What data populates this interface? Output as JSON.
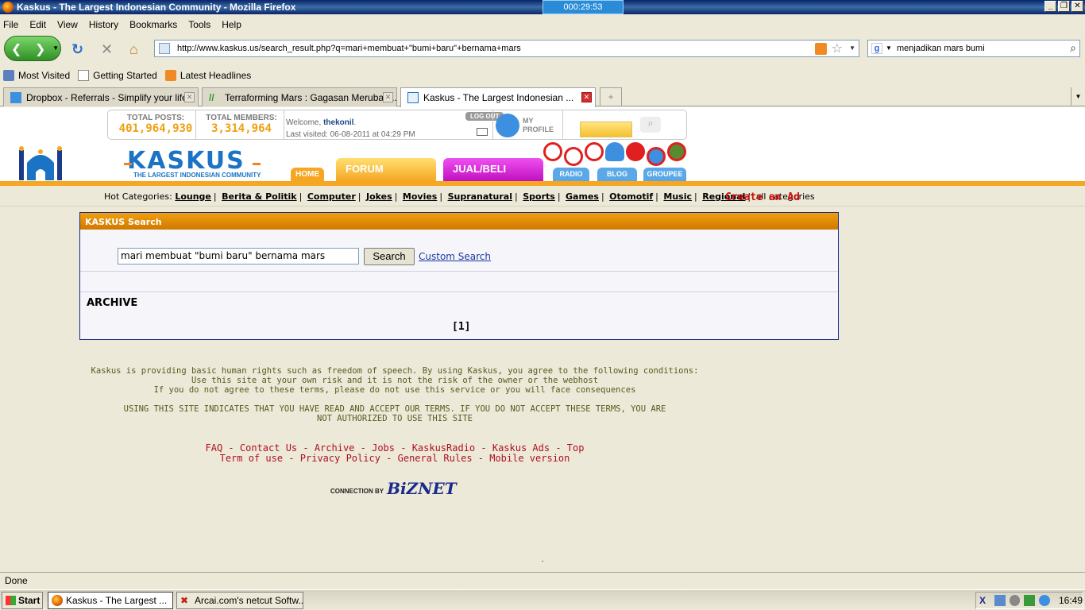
{
  "window": {
    "title": "Kaskus - The Largest Indonesian Community - Mozilla Firefox",
    "timer": "000:29:53"
  },
  "menu": [
    "File",
    "Edit",
    "View",
    "History",
    "Bookmarks",
    "Tools",
    "Help"
  ],
  "nav": {
    "url": "http://www.kaskus.us/search_result.php?q=mari+membuat+\"bumi+baru\"+bernama+mars",
    "search_value": "menjadikan mars bumi"
  },
  "bookmarks": [
    "Most Visited",
    "Getting Started",
    "Latest Headlines"
  ],
  "tabs": [
    {
      "label": "Dropbox - Referrals - Simplify your life",
      "active": false
    },
    {
      "label": "Terraforming Mars : Gagasan Merubah ...",
      "active": false
    },
    {
      "label": "Kaskus - The Largest Indonesian ...",
      "active": true
    }
  ],
  "header": {
    "total_posts_label": "TOTAL POSTS:",
    "total_posts": "401,964,930",
    "total_members_label": "TOTAL MEMBERS:",
    "total_members": "3,314,964",
    "welcome_prefix": "Welcome,",
    "username": "thekonil",
    "last_visited": "Last visited: 06-08-2011 at 04:29 PM",
    "logout": "LOG OUT",
    "my_profile": "MY PROFILE",
    "logo_text": "KASKUS",
    "logo_tagline": "THE LARGEST INDONESIAN COMMUNITY",
    "nav_home": "HOME",
    "nav_forum": "FORUM",
    "nav_jualbeli": "JUAL/BELI",
    "nav_radio": "RADIO",
    "nav_blog": "BLOG",
    "nav_groupee": "GROUPEE"
  },
  "hot": {
    "label": "Hot Categories:",
    "categories": [
      "Lounge",
      "Berita & Politik",
      "Computer",
      "Jokes",
      "Movies",
      "Supranatural",
      "Sports",
      "Games",
      "Otomotif",
      "Music",
      "Regional"
    ],
    "all": "all categories",
    "create_ad": "Create an Ad"
  },
  "search": {
    "heading": "KASKUS Search",
    "query": "mari membuat \"bumi baru\" bernama mars",
    "button": "Search",
    "custom": "Custom Search",
    "archive": "ARCHIVE",
    "pager": "[1]"
  },
  "footer": {
    "terms1": "Kaskus is providing basic human rights such as freedom of speech. By using Kaskus, you agree to the following conditions:",
    "terms2": "Use this site at your own risk and it is not the risk of the owner or the webhost",
    "terms3": "If you do not agree to these terms, please do not use this service or you will face consequences",
    "terms4": "USING THIS SITE INDICATES THAT YOU HAVE READ AND ACCEPT OUR TERMS. IF YOU DO NOT ACCEPT THESE TERMS, YOU ARE",
    "terms5": "NOT AUTHORIZED TO USE THIS SITE",
    "links1": [
      "FAQ",
      "Contact Us",
      "Archive",
      "Jobs",
      "KaskusRadio",
      "Kaskus Ads",
      "Top"
    ],
    "links2": [
      "Term of use",
      "Privacy Policy",
      "General Rules",
      "Mobile version"
    ],
    "connection": "CONNECTION BY",
    "biznet": "BiZNET",
    "dot": "."
  },
  "status": "Done",
  "taskbar": {
    "start": "Start",
    "tasks": [
      "Kaskus - The Largest ...",
      "Arcai.com's netcut Softw..."
    ],
    "clock": "16:49"
  },
  "colors": {
    "accent_orange": "#f5a623",
    "kaskus_blue": "#1a73c4",
    "link_red": "#b01020"
  }
}
